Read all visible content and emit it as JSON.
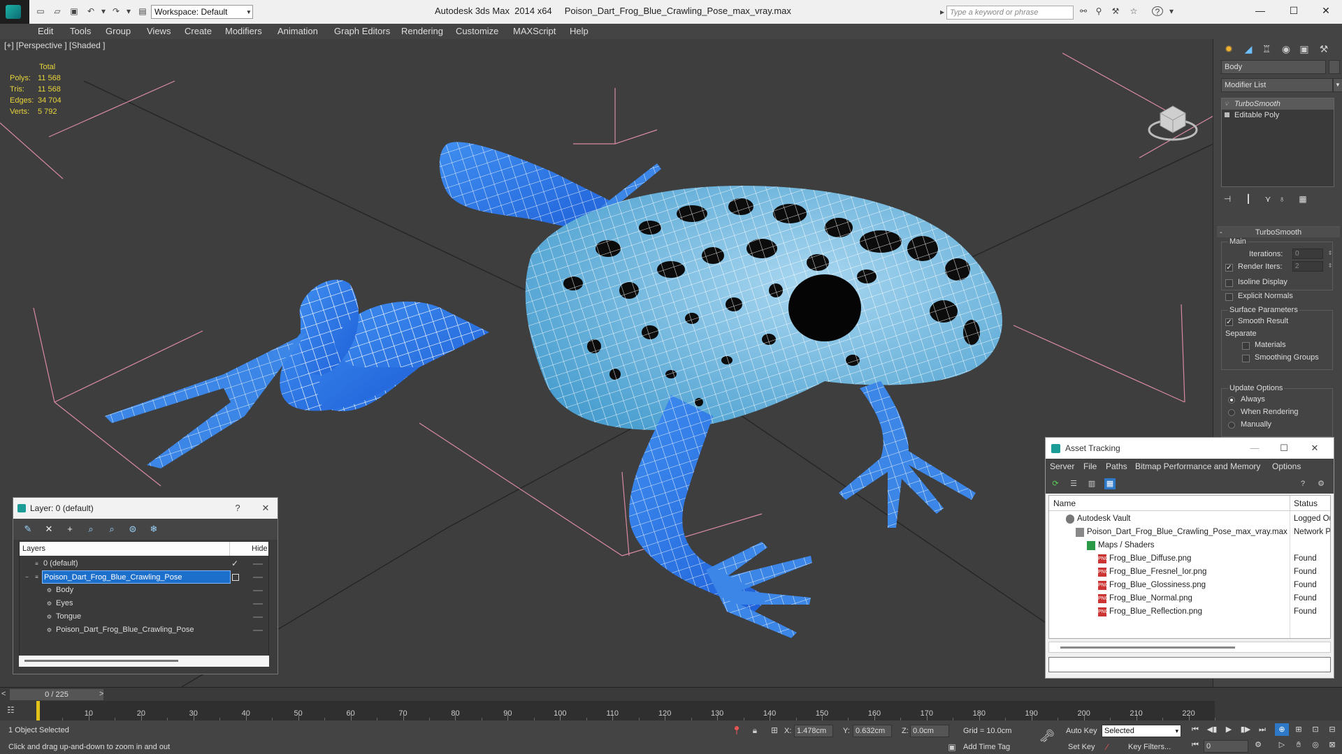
{
  "titlebar": {
    "workspace": "Workspace: Default",
    "title": "Autodesk 3ds Max  2014 x64     Poison_Dart_Frog_Blue_Crawling_Pose_max_vray.max",
    "search_placeholder": "Type a keyword or phrase"
  },
  "menu": [
    "Edit",
    "Tools",
    "Group",
    "Views",
    "Create",
    "Modifiers",
    "Animation",
    "Graph Editors",
    "Rendering",
    "Customize",
    "MAXScript",
    "Help"
  ],
  "viewport": {
    "label": "[+] [Perspective ] [Shaded ]",
    "stats_total": "Total",
    "stats": [
      {
        "k": "Polys:",
        "v": "11 568"
      },
      {
        "k": "Tris:",
        "v": "11 568"
      },
      {
        "k": "Edges:",
        "v": "34 704"
      },
      {
        "k": "Verts:",
        "v": "5 792"
      }
    ]
  },
  "cmdpanel": {
    "object_name": "Body",
    "modifier_list": "Modifier List",
    "stack": [
      "TurboSmooth",
      "Editable Poly"
    ],
    "rollout_title": "TurboSmooth",
    "main_group": "Main",
    "iterations_label": "Iterations:",
    "iterations_value": "0",
    "render_iters_label": "Render Iters:",
    "render_iters_value": "2",
    "isoline_label": "Isoline Display",
    "explicit_label": "Explicit Normals",
    "surface_group": "Surface Parameters",
    "smooth_result_label": "Smooth Result",
    "separate_label": "Separate",
    "materials_label": "Materials",
    "smoothing_groups_label": "Smoothing Groups",
    "update_group": "Update Options",
    "always_label": "Always",
    "when_rendering_label": "When Rendering",
    "manually_label": "Manually"
  },
  "layer_dialog": {
    "title": "Layer: 0 (default)",
    "col_layers": "Layers",
    "col_hide": "Hide",
    "rows": [
      {
        "name": "0 (default)",
        "indent": 0,
        "check": true,
        "selected": false
      },
      {
        "name": "Poison_Dart_Frog_Blue_Crawling_Pose",
        "indent": 0,
        "check": false,
        "selected": true
      },
      {
        "name": "Body",
        "indent": 1,
        "check": false,
        "selected": false
      },
      {
        "name": "Eyes",
        "indent": 1,
        "check": false,
        "selected": false
      },
      {
        "name": "Tongue",
        "indent": 1,
        "check": false,
        "selected": false
      },
      {
        "name": "Poison_Dart_Frog_Blue_Crawling_Pose",
        "indent": 1,
        "check": false,
        "selected": false
      }
    ]
  },
  "asset_dialog": {
    "title": "Asset Tracking",
    "menu": [
      "Server",
      "File",
      "Paths",
      "Bitmap Performance and Memory",
      "Options"
    ],
    "col_name": "Name",
    "col_status": "Status",
    "rows": [
      {
        "name": "Autodesk Vault",
        "status": "Logged Ou",
        "type": "vault",
        "indent": 1
      },
      {
        "name": "Poison_Dart_Frog_Blue_Crawling_Pose_max_vray.max",
        "status": "Network P",
        "type": "max",
        "indent": 2
      },
      {
        "name": "Maps / Shaders",
        "status": "",
        "type": "map",
        "indent": 3
      },
      {
        "name": "Frog_Blue_Diffuse.png",
        "status": "Found",
        "type": "png",
        "indent": 4
      },
      {
        "name": "Frog_Blue_Fresnel_Ior.png",
        "status": "Found",
        "type": "png",
        "indent": 4
      },
      {
        "name": "Frog_Blue_Glossiness.png",
        "status": "Found",
        "type": "png",
        "indent": 4
      },
      {
        "name": "Frog_Blue_Normal.png",
        "status": "Found",
        "type": "png",
        "indent": 4
      },
      {
        "name": "Frog_Blue_Reflection.png",
        "status": "Found",
        "type": "png",
        "indent": 4
      }
    ]
  },
  "timeline": {
    "frame": "0 / 225",
    "prev": "<",
    "next": ">",
    "ticks": [
      "10",
      "20",
      "30",
      "40",
      "50",
      "60",
      "70",
      "80",
      "90",
      "100",
      "110",
      "120",
      "130",
      "140",
      "150",
      "160",
      "170",
      "180",
      "190",
      "200",
      "210",
      "220"
    ]
  },
  "status": {
    "selected": "1 Object Selected",
    "hint": "Click and drag up-and-down to zoom in and out",
    "x_label": "X:",
    "x_value": "1.478cm",
    "y_label": "Y:",
    "y_value": "0.632cm",
    "z_label": "Z:",
    "z_value": "0.0cm",
    "grid": "Grid = 10.0cm",
    "auto_key": "Auto Key",
    "selected_dd": "Selected",
    "set_key": "Set Key",
    "key_filters": "Key Filters...",
    "add_time_tag": "Add Time Tag",
    "frame_field": "0"
  }
}
